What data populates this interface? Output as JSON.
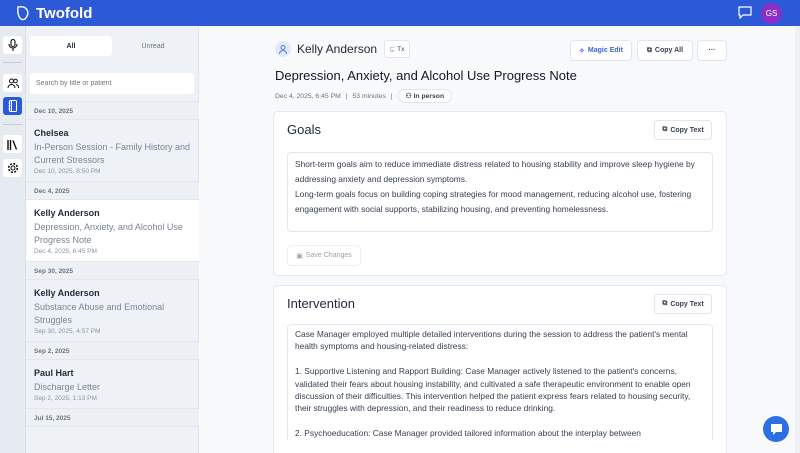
{
  "app": {
    "name": "Twofold",
    "user_initials": "GS",
    "user_color": "#8b2fc9",
    "accent": "#2c59d5"
  },
  "rail": {
    "icons": [
      "microphone-icon",
      "people-icon",
      "notebook-icon",
      "library-icon",
      "gear-icon"
    ]
  },
  "list": {
    "tabs": [
      {
        "label": "All",
        "active": true
      },
      {
        "label": "Unread",
        "active": false
      }
    ],
    "search_placeholder": "Search by title or patient",
    "groups": [
      {
        "date": "Dec 10, 2025",
        "items": [
          {
            "name": "Chelsea",
            "title": "In-Person Session - Family History and Current Stressors",
            "time": "Dec 10, 2025, 8:50 PM"
          }
        ]
      },
      {
        "date": "Dec 4, 2025",
        "items": [
          {
            "name": "Kelly Anderson",
            "title": "Depression, Anxiety, and Alcohol Use Progress Note",
            "time": "Dec 4, 2025, 6:45 PM",
            "selected": true
          }
        ]
      },
      {
        "date": "Sep 30, 2025",
        "items": [
          {
            "name": "Kelly Anderson",
            "title": "Substance Abuse and Emotional Struggles",
            "time": "Sep 30, 2025, 4:57 PM"
          }
        ]
      },
      {
        "date": "Sep 2, 2025",
        "items": [
          {
            "name": "Paul Hart",
            "title": "Discharge Letter",
            "time": "Sep 2, 2025, 1:13 PM"
          }
        ]
      },
      {
        "date": "Jul 15, 2025",
        "items": []
      }
    ]
  },
  "note": {
    "patient": "Kelly Anderson",
    "tx_label": "Tx",
    "magic_edit": "Magic Edit",
    "copy_all": "Copy All",
    "more": "···",
    "title": "Depression, Anxiety, and Alcohol Use Progress Note",
    "datetime": "Dec 4, 2025, 6:45 PM",
    "sep": "|",
    "duration": "53 minutes",
    "mode": "In person",
    "sections": [
      {
        "heading": "Goals",
        "copy": "Copy Text",
        "save": "Save Changes",
        "body": "Short-term goals aim to reduce immediate distress related to housing stability and improve sleep hygiene by addressing anxiety and depression symptoms.\nLong-term goals focus on building coping strategies for mood management, reducing alcohol use, fostering engagement with social supports, stabilizing housing, and preventing homelessness."
      },
      {
        "heading": "Intervention",
        "copy": "Copy Text",
        "body": "Case Manager employed multiple detailed interventions during the session to address the patient's mental health symptoms and housing-related distress:\n\n1. Supportive Listening and Rapport Building: Case Manager actively listened to the patient's concerns, validated their fears about housing instability, and cultivated a safe therapeutic environment to enable open discussion of their difficulties. This intervention helped the patient express fears related to housing security, their struggles with depression, and their readiness to reduce drinking.\n\n2. Psychoeducation: Case Manager provided tailored information about the interplay between"
      }
    ]
  }
}
